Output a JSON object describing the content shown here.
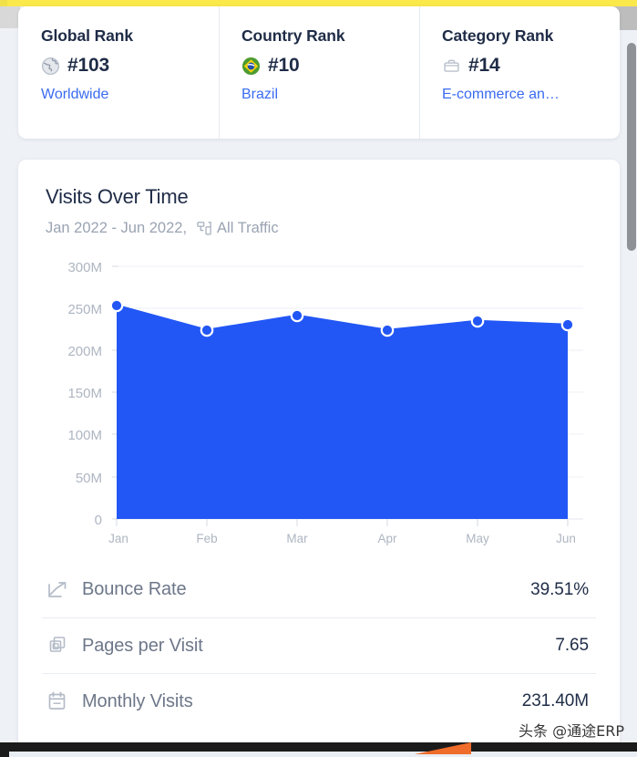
{
  "chrome": {
    "top_strip_color": "#fbe84a",
    "scrollbar_color": "#8e9196",
    "accent_orange": "#ef6c2a"
  },
  "ranks": [
    {
      "title": "Global Rank",
      "icon": "globe-icon",
      "value": "#103",
      "link": "Worldwide"
    },
    {
      "title": "Country Rank",
      "icon": "brazil-flag-icon",
      "value": "#10",
      "link": "Brazil"
    },
    {
      "title": "Category Rank",
      "icon": "briefcase-icon",
      "value": "#14",
      "link": "E-commerce an…"
    }
  ],
  "visits": {
    "title": "Visits Over Time",
    "date_range": "Jan 2022 - Jun 2022,",
    "traffic_icon": "traffic-segments-icon",
    "traffic_label": "All Traffic"
  },
  "metrics": [
    {
      "icon": "trending-arrow-icon",
      "label": "Bounce Rate",
      "value": "39.51%"
    },
    {
      "icon": "stacked-pages-icon",
      "label": "Pages per Visit",
      "value": "7.65"
    },
    {
      "icon": "calendar-icon",
      "label": "Monthly Visits",
      "value": "231.40M"
    }
  ],
  "watermark": {
    "text": "头条 @通途ERP"
  },
  "chart_data": {
    "type": "area",
    "title": "Visits Over Time",
    "subtitle": "Jan 2022 - Jun 2022, All Traffic",
    "categories": [
      "Jan",
      "Feb",
      "Mar",
      "Apr",
      "May",
      "Jun"
    ],
    "values": [
      254000000,
      225000000,
      242000000,
      225000000,
      236000000,
      231400000
    ],
    "value_labels": [
      "254M",
      "225M",
      "242M",
      "225M",
      "236M",
      "231.40M"
    ],
    "ytick_labels": [
      "300M",
      "250M",
      "200M",
      "150M",
      "100M",
      "50M",
      "0"
    ],
    "yticks": [
      300000000,
      250000000,
      200000000,
      150000000,
      100000000,
      50000000,
      0
    ],
    "ylim": [
      0,
      300000000
    ],
    "xlabel": "",
    "ylabel": "",
    "grid": true,
    "legend": "none",
    "series_color": "#2257f5",
    "marker_color": "#2257f5",
    "marker_edge_color": "#ffffff",
    "gridline_color": "#eceff4",
    "tick_label_color": "#aeb6c2"
  }
}
